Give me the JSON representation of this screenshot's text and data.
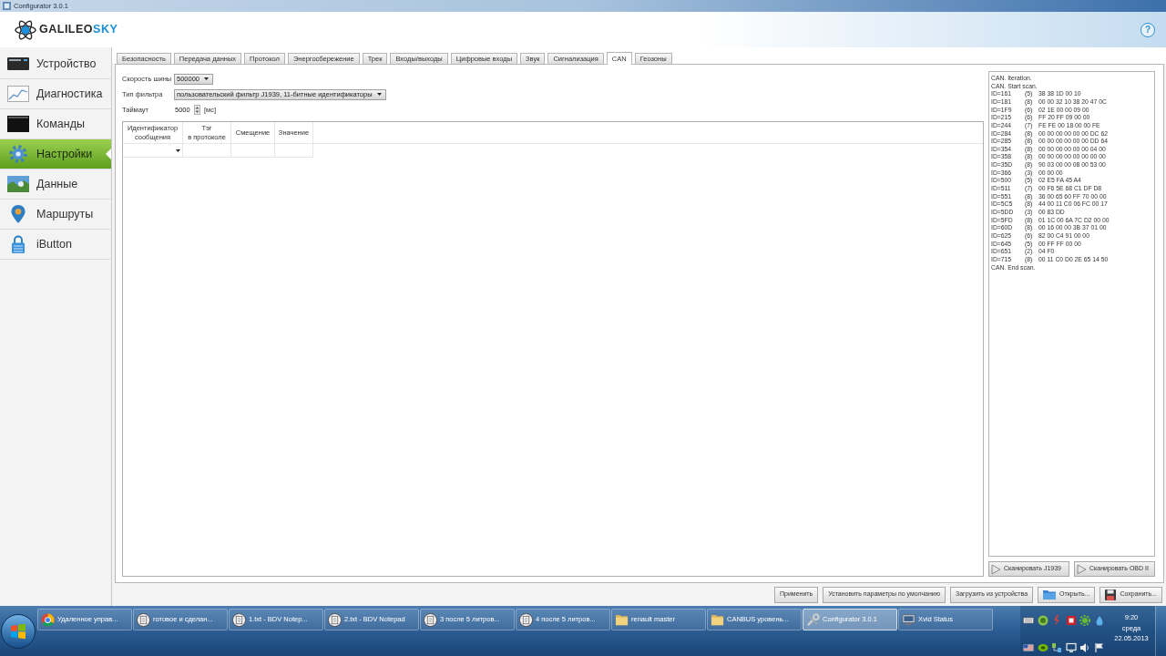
{
  "window": {
    "title": "Configurator 3.0.1"
  },
  "header": {
    "logo": {
      "text": "GALILEO",
      "accent": "SKY"
    },
    "help": "?"
  },
  "sidebar": {
    "items": [
      {
        "label": "Устройство",
        "kind": "device",
        "selected": false
      },
      {
        "label": "Диагностика",
        "kind": "diagnostics",
        "selected": false
      },
      {
        "label": "Команды",
        "kind": "commands",
        "selected": false
      },
      {
        "label": "Настройки",
        "kind": "settings",
        "selected": true
      },
      {
        "label": "Данные",
        "kind": "data",
        "selected": false
      },
      {
        "label": "Маршруты",
        "kind": "routes",
        "selected": false
      },
      {
        "label": "iButton",
        "kind": "ibutton",
        "selected": false
      }
    ]
  },
  "tabs": [
    {
      "label": "Безопасность",
      "selected": false
    },
    {
      "label": "Передача данных",
      "selected": false
    },
    {
      "label": "Протокол",
      "selected": false
    },
    {
      "label": "Энергосбережение",
      "selected": false
    },
    {
      "label": "Трек",
      "selected": false
    },
    {
      "label": "Входы/выходы",
      "selected": false
    },
    {
      "label": "Цифровые входы",
      "selected": false
    },
    {
      "label": "Звук",
      "selected": false
    },
    {
      "label": "Сигнализация",
      "selected": false
    },
    {
      "label": "CAN",
      "selected": true
    },
    {
      "label": "Геозоны",
      "selected": false
    }
  ],
  "can": {
    "bus_speed": {
      "label": "Скорость шины",
      "value": "500000"
    },
    "filter_type": {
      "label": "Тип фильтра",
      "value": "пользовательский фильтр J1939, 11-битные идентификаторы"
    },
    "timeout": {
      "label": "Таймаут",
      "value": "5000",
      "unit": "[мс]"
    },
    "table": {
      "columns": [
        "Идентификатор\nсообщения",
        "Тэг\nв протоколе",
        "Смещение",
        "Значение"
      ]
    },
    "log": [
      {
        "kind": "message",
        "text": "CAN. Iteration."
      },
      {
        "kind": "message",
        "text": "CAN. Start scan."
      },
      {
        "kind": "frame",
        "id": "ID=161",
        "length": "(5)",
        "data": "38 38 1D 00 10"
      },
      {
        "kind": "frame",
        "id": "ID=181",
        "length": "(8)",
        "data": "00 00 32 10 38 20 47 0C"
      },
      {
        "kind": "frame",
        "id": "ID=1F9",
        "length": "(6)",
        "data": "02 1E 00 00 09 00"
      },
      {
        "kind": "frame",
        "id": "ID=215",
        "length": "(6)",
        "data": "FF 20 FF 09 00 00"
      },
      {
        "kind": "frame",
        "id": "ID=244",
        "length": "(7)",
        "data": "FE FE 00 18 00 00 FE"
      },
      {
        "kind": "frame",
        "id": "ID=284",
        "length": "(8)",
        "data": "00 00 00 00 00 00 DC 62"
      },
      {
        "kind": "frame",
        "id": "ID=285",
        "length": "(8)",
        "data": "00 00 00 00 00 00 DD 64"
      },
      {
        "kind": "frame",
        "id": "ID=354",
        "length": "(8)",
        "data": "00 00 00 00 00 00 04 00"
      },
      {
        "kind": "frame",
        "id": "ID=358",
        "length": "(8)",
        "data": "00 00 00 00 00 00 00 00"
      },
      {
        "kind": "frame",
        "id": "ID=35D",
        "length": "(8)",
        "data": "90 03 00 00 08 00 53 00"
      },
      {
        "kind": "frame",
        "id": "ID=366",
        "length": "(3)",
        "data": "00 00 00"
      },
      {
        "kind": "frame",
        "id": "ID=500",
        "length": "(5)",
        "data": "02 E5 FA 45 A4"
      },
      {
        "kind": "frame",
        "id": "ID=511",
        "length": "(7)",
        "data": "00 F6 5E 68 C1 DF D8"
      },
      {
        "kind": "frame",
        "id": "ID=551",
        "length": "(8)",
        "data": "36 00 65 60 FF 70 00 00"
      },
      {
        "kind": "frame",
        "id": "ID=5C5",
        "length": "(8)",
        "data": "44 00 11 C0 06 FC 00 17"
      },
      {
        "kind": "frame",
        "id": "ID=5DD",
        "length": "(3)",
        "data": "00 83 DD"
      },
      {
        "kind": "frame",
        "id": "ID=5FD",
        "length": "(8)",
        "data": "01 1C 00 6A 7C D2 00 00"
      },
      {
        "kind": "frame",
        "id": "ID=60D",
        "length": "(8)",
        "data": "00 16 00 00 3B 37 01 00"
      },
      {
        "kind": "frame",
        "id": "ID=625",
        "length": "(6)",
        "data": "82 00 C4 91 00 00"
      },
      {
        "kind": "frame",
        "id": "ID=645",
        "length": "(5)",
        "data": "00 FF FF 00 00"
      },
      {
        "kind": "frame",
        "id": "ID=651",
        "length": "(2)",
        "data": "04 F0"
      },
      {
        "kind": "frame",
        "id": "ID=715",
        "length": "(8)",
        "data": "00 11 C0 D0 2E 65 14 50"
      },
      {
        "kind": "message",
        "text": "CAN. End scan."
      }
    ],
    "scan_buttons": [
      "Сканировать J1939",
      "Сканировать OBD II"
    ]
  },
  "footer_buttons": [
    {
      "label": "Применить",
      "kind": "plain"
    },
    {
      "label": "Установить параметры по умолчанию",
      "kind": "plain"
    },
    {
      "label": "Загрузить из устройства",
      "kind": "plain"
    },
    {
      "label": "Открыть...",
      "kind": "open"
    },
    {
      "label": "Сохранить...",
      "kind": "save"
    }
  ],
  "taskbar": {
    "tasks": [
      {
        "label": "Удаленное управ...",
        "kind": "browser",
        "selected": false
      },
      {
        "label": "готовое и сделан...",
        "kind": "notepad",
        "selected": false
      },
      {
        "label": "1.txt - BDV Notep...",
        "kind": "notepad",
        "selected": false
      },
      {
        "label": "2.txt - BDV Notepad",
        "kind": "notepad",
        "selected": false
      },
      {
        "label": "3 после 5 литров...",
        "kind": "notepad",
        "selected": false
      },
      {
        "label": "4 после 5 литров...",
        "kind": "notepad",
        "selected": false
      },
      {
        "label": "renault master",
        "kind": "folder",
        "selected": false
      },
      {
        "label": "CANBUS уровень...",
        "kind": "folder",
        "selected": false
      },
      {
        "label": "Configurator 3.0.1",
        "kind": "tools",
        "selected": true
      },
      {
        "label": "Xvid Status",
        "kind": "monitor",
        "selected": false
      }
    ],
    "clock": {
      "time": "9:20",
      "day": "среда",
      "date": "22.05.2013"
    }
  }
}
